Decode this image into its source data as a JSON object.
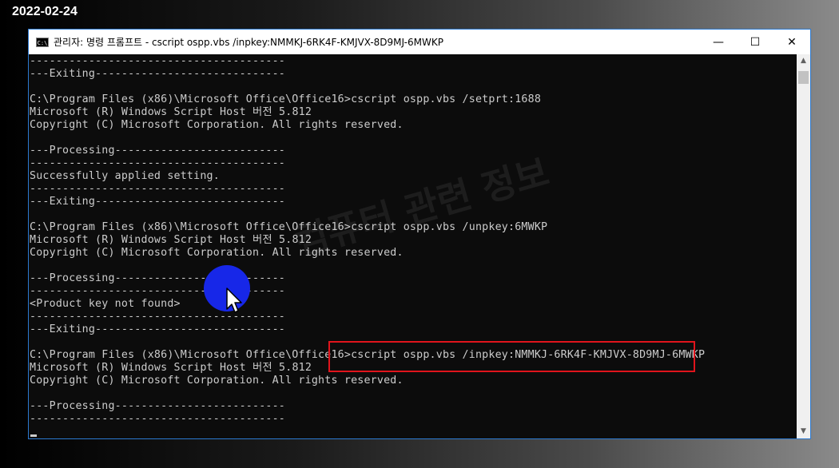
{
  "date_stamp": "2022-02-24",
  "window": {
    "title": "관리자: 명령 프롬프트 - cscript  ospp.vbs /inpkey:NMMKJ-6RK4F-KMJVX-8D9MJ-6MWKP",
    "icon": "cmd-icon",
    "icon_label": "C:\\",
    "controls": [
      {
        "name": "minimize",
        "glyph": "—"
      },
      {
        "name": "maximize",
        "glyph": "☐"
      },
      {
        "name": "close",
        "glyph": "✕"
      }
    ]
  },
  "console": {
    "lines": [
      "---------------------------------------",
      "---Exiting-----------------------------",
      "",
      "C:\\Program Files (x86)\\Microsoft Office\\Office16>cscript ospp.vbs /setprt:1688",
      "Microsoft (R) Windows Script Host 버전 5.812",
      "Copyright (C) Microsoft Corporation. All rights reserved.",
      "",
      "---Processing--------------------------",
      "---------------------------------------",
      "Successfully applied setting.",
      "---------------------------------------",
      "---Exiting-----------------------------",
      "",
      "C:\\Program Files (x86)\\Microsoft Office\\Office16>cscript ospp.vbs /unpkey:6MWKP",
      "Microsoft (R) Windows Script Host 버전 5.812",
      "Copyright (C) Microsoft Corporation. All rights reserved.",
      "",
      "---Processing--------------------------",
      "---------------------------------------",
      "<Product key not found>",
      "---------------------------------------",
      "---Exiting-----------------------------",
      "",
      "C:\\Program Files (x86)\\Microsoft Office\\Office16>cscript ospp.vbs /inpkey:NMMKJ-6RK4F-KMJVX-8D9MJ-6MWKP",
      "Microsoft (R) Windows Script Host 버전 5.812",
      "Copyright (C) Microsoft Corporation. All rights reserved.",
      "",
      "---Processing--------------------------",
      "---------------------------------------"
    ]
  },
  "watermark": "컴퓨터 관련 정보",
  "colors": {
    "console_bg": "#0c0c0c",
    "console_text": "#cccccc",
    "highlight": "#e0141c",
    "click_marker": "#1727e8",
    "window_border": "#2b79d0"
  }
}
